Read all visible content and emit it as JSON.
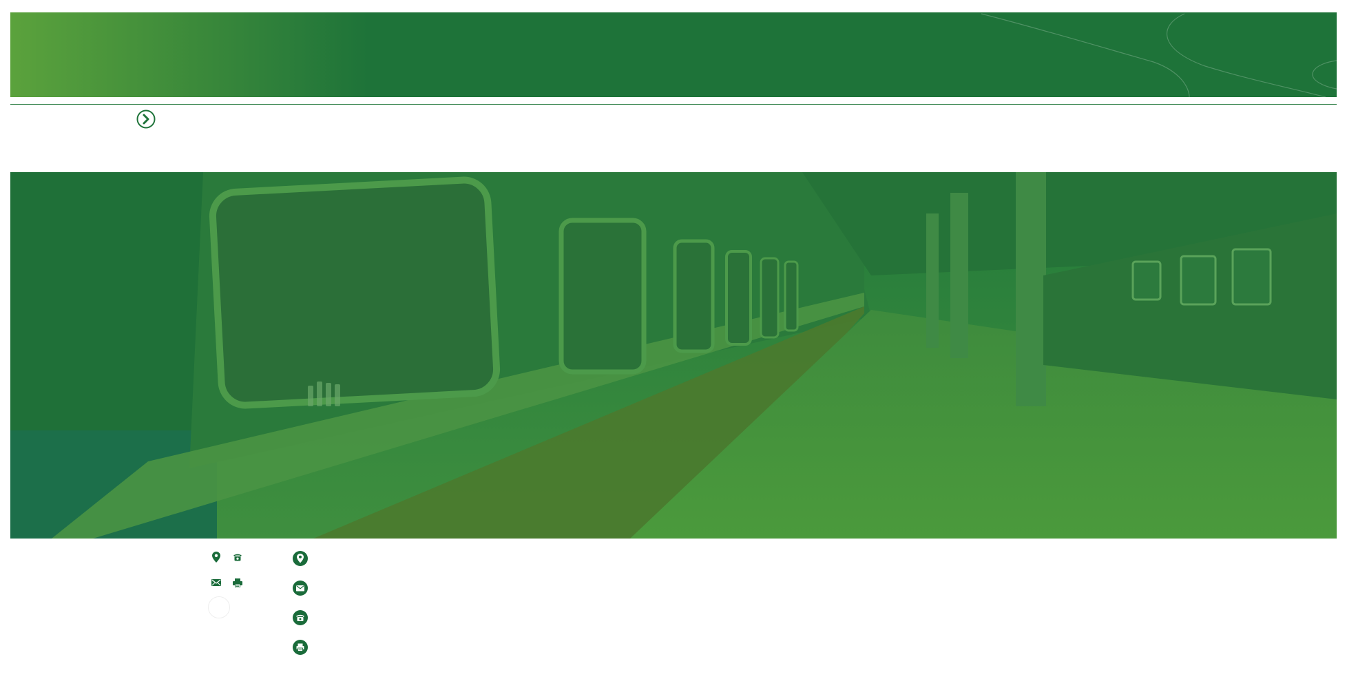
{
  "colors": {
    "brand_dark": "#1e7339",
    "brand_light": "#5ba23c",
    "rule": "#2f7f46",
    "icon_bg": "#1a6b3a",
    "white": "#ffffff"
  },
  "header": {
    "banner_icon": "decorative-curves"
  },
  "navigation": {
    "next_icon": "chevron-right-circle-icon"
  },
  "hero": {
    "image_subject": "train-platform-photo"
  },
  "contact_small": {
    "icons": [
      "location-pin-icon",
      "telephone-icon",
      "envelope-icon",
      "printer-icon"
    ]
  },
  "contact_list": {
    "items": [
      {
        "icon": "location-pin-icon",
        "text": ""
      },
      {
        "icon": "envelope-icon",
        "text": ""
      },
      {
        "icon": "telephone-icon",
        "text": ""
      },
      {
        "icon": "printer-icon",
        "text": ""
      }
    ]
  }
}
